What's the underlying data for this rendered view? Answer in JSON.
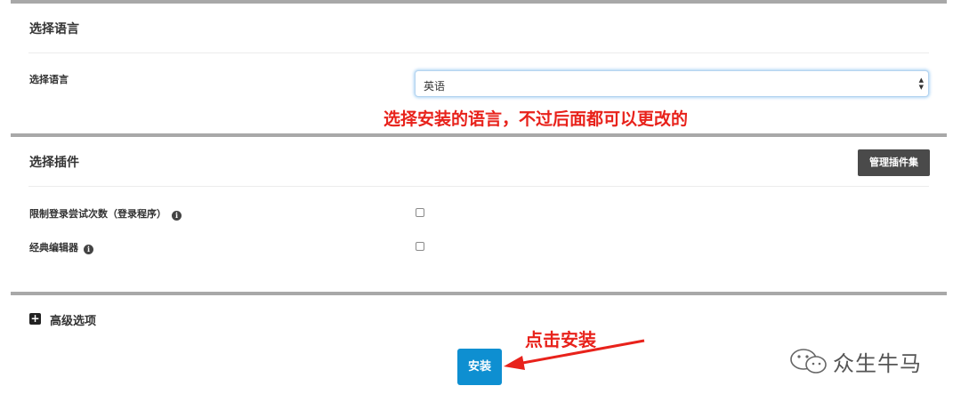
{
  "language_section": {
    "title": "选择语言",
    "field_label": "选择语言",
    "selected_value": "英语",
    "annotation": "选择安装的语言，不过后面都可以更改的"
  },
  "plugins_section": {
    "title": "选择插件",
    "manage_button": "管理插件集",
    "plugins": [
      {
        "label": "限制登录尝试次数（登录程序）",
        "checked": false
      },
      {
        "label": "经典编辑器",
        "checked": false
      }
    ]
  },
  "advanced": {
    "label": "高级选项"
  },
  "install_button": "安装",
  "install_annotation": "点击安装",
  "watermark": "众生牛马",
  "colors": {
    "accent": "#0e8fd1",
    "annotation": "#e8221b",
    "button_dark": "#4a4a4a"
  },
  "icons": [
    "info-icon",
    "plus-square-icon",
    "select-caret-icon",
    "wechat-logo-icon",
    "red-arrow"
  ]
}
